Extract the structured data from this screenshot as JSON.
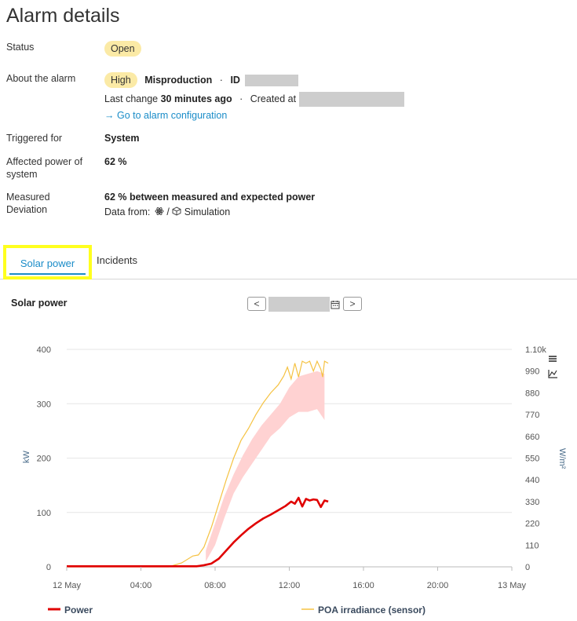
{
  "page": {
    "title": "Alarm details"
  },
  "details": {
    "status_label": "Status",
    "status_value": "Open",
    "about_label": "About the alarm",
    "severity": "High",
    "alarm_type": "Misproduction",
    "id_sep": "·",
    "id_label": "ID",
    "last_change_label": "Last change",
    "last_change_value": "30 minutes ago",
    "created_sep": "·",
    "created_label": "Created at",
    "config_link": "→ Go to alarm configuration",
    "triggered_label": "Triggered for",
    "triggered_value": "System",
    "affected_label": "Affected power of system",
    "affected_value": "62 %",
    "deviation_label": "Measured Deviation",
    "deviation_value": "62 % between measured and expected power",
    "data_from_label": "Data from:",
    "data_from_sep": "/",
    "data_from_sim": "Simulation"
  },
  "tabs": [
    {
      "label": "Solar power",
      "active": true
    },
    {
      "label": "Incidents",
      "active": false
    }
  ],
  "chart_header": {
    "title": "Solar power",
    "prev": "<",
    "next": ">"
  },
  "chart_data": {
    "type": "line",
    "x_ticks": [
      "12 May",
      "04:00",
      "08:00",
      "12:00",
      "16:00",
      "20:00",
      "13 May"
    ],
    "y_left": {
      "label": "kW",
      "ticks": [
        "0",
        "100",
        "200",
        "300",
        "400"
      ],
      "range": [
        0,
        400
      ]
    },
    "y_right": {
      "label": "W/m²",
      "ticks": [
        "0",
        "110",
        "220",
        "330",
        "440",
        "550",
        "660",
        "770",
        "880",
        "990",
        "1.10k"
      ],
      "range": [
        0,
        1100
      ]
    },
    "x_range_hours": [
      0,
      24
    ],
    "grid": true,
    "legend_position": "bottom",
    "colors": {
      "power": "#e00000",
      "poa": "#f5c242",
      "band": "#ffd2d2"
    },
    "series": [
      {
        "name": "Power",
        "axis": "left",
        "hours": [
          0,
          6.5,
          7.0,
          7.4,
          7.8,
          8.2,
          8.6,
          9.0,
          9.4,
          9.8,
          10.2,
          10.6,
          11.0,
          11.4,
          11.8,
          12.1,
          12.3,
          12.5,
          12.7,
          12.9,
          13.1,
          13.3,
          13.5,
          13.7,
          13.9,
          14.1
        ],
        "values": [
          1,
          1,
          1,
          3,
          6,
          15,
          30,
          45,
          58,
          70,
          80,
          89,
          96,
          104,
          112,
          120,
          116,
          127,
          111,
          125,
          122,
          124,
          123,
          110,
          122,
          120
        ]
      },
      {
        "name": "POA irradiance (sensor)",
        "axis": "right",
        "hours": [
          0,
          5.5,
          6.2,
          6.8,
          7.1,
          7.4,
          7.8,
          8.2,
          8.6,
          9.0,
          9.4,
          9.8,
          10.2,
          10.6,
          11.0,
          11.4,
          11.7,
          11.9,
          12.1,
          12.3,
          12.5,
          12.7,
          12.9,
          13.1,
          13.3,
          13.5,
          13.7,
          13.8,
          13.9,
          14.1
        ],
        "values": [
          0,
          0,
          20,
          55,
          60,
          100,
          200,
          320,
          440,
          550,
          640,
          700,
          770,
          830,
          880,
          920,
          965,
          1010,
          950,
          1030,
          960,
          1040,
          1030,
          1040,
          990,
          1040,
          1000,
          960,
          1040,
          1030
        ]
      }
    ],
    "expected_band": {
      "axis": "left",
      "hours": [
        7.5,
        8.0,
        8.5,
        9.0,
        9.5,
        10.0,
        10.5,
        11.0,
        11.5,
        12.0,
        12.5,
        13.0,
        13.5,
        13.9
      ],
      "upper": [
        30,
        80,
        130,
        170,
        205,
        235,
        260,
        280,
        300,
        330,
        350,
        355,
        360,
        355
      ],
      "lower": [
        10,
        40,
        90,
        135,
        165,
        190,
        215,
        240,
        255,
        275,
        285,
        285,
        290,
        270
      ]
    }
  }
}
